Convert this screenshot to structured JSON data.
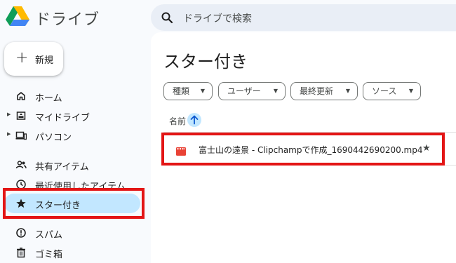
{
  "app": {
    "name": "ドライブ"
  },
  "search": {
    "placeholder": "ドライブで検索"
  },
  "new_button": {
    "label": "新規"
  },
  "nav": [
    {
      "label": "ホーム",
      "icon": "home-icon"
    },
    {
      "label": "マイドライブ",
      "icon": "my-drive-icon",
      "expandable": true
    },
    {
      "label": "パソコン",
      "icon": "computer-icon",
      "expandable": true
    },
    {
      "label": "共有アイテム",
      "icon": "shared-icon"
    },
    {
      "label": "最近使用したアイテム",
      "icon": "recent-icon"
    },
    {
      "label": "スター付き",
      "icon": "star-icon",
      "active": true
    },
    {
      "label": "スパム",
      "icon": "spam-icon"
    },
    {
      "label": "ゴミ箱",
      "icon": "trash-icon"
    }
  ],
  "main": {
    "title": "スター付き",
    "filters": [
      "種類",
      "ユーザー",
      "最終更新",
      "ソース"
    ],
    "sort_label": "名前",
    "files": [
      {
        "name": "富士山の遠景 - Clipchampで作成_1690442690200.mp4",
        "type": "video",
        "starred": true
      }
    ]
  },
  "colors": {
    "active_bg": "#c2e7ff",
    "highlight": "#e31515",
    "video_icon": "#e94235"
  }
}
